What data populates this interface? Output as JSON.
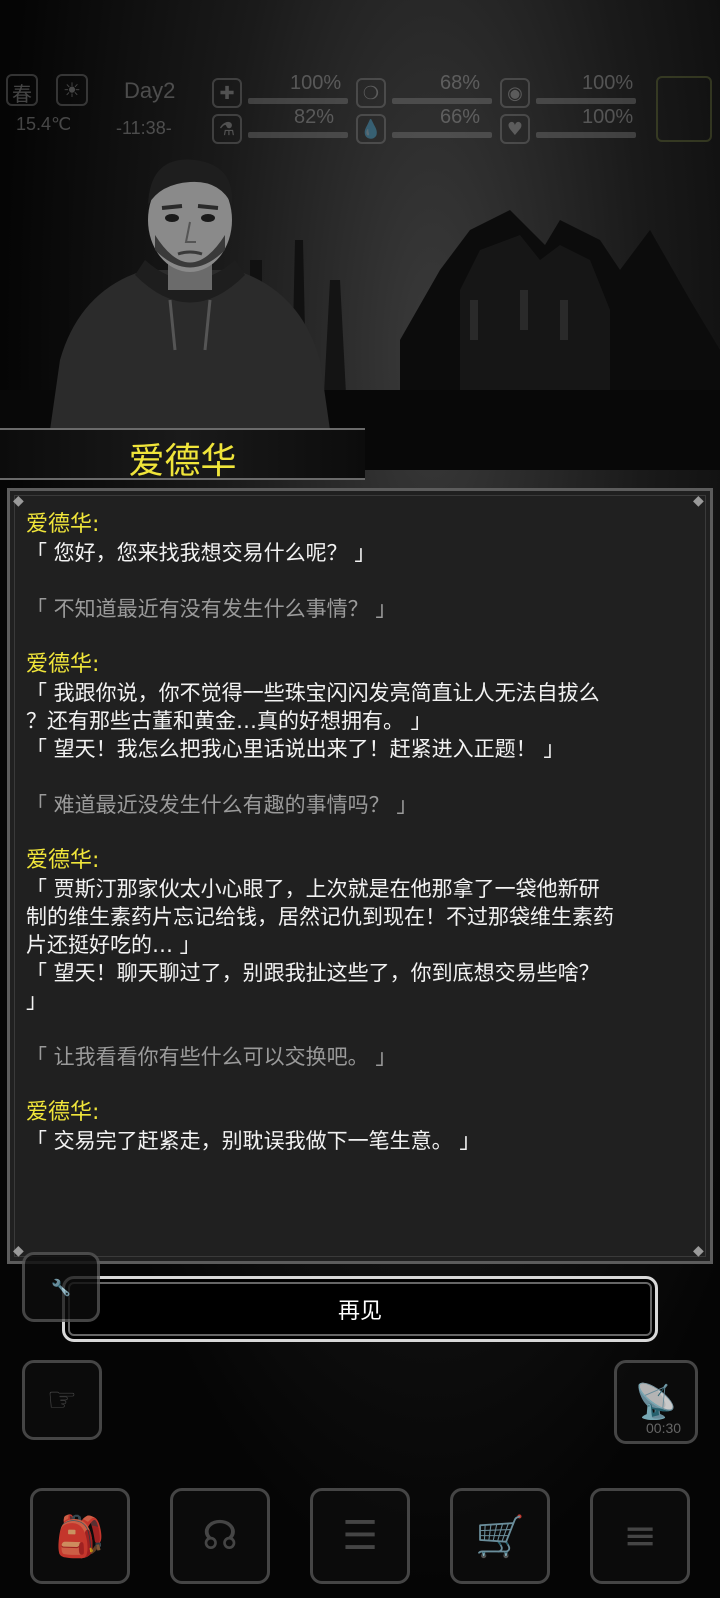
{
  "hud": {
    "season": "春",
    "temperature": "15.4℃",
    "day": "Day2",
    "time": "-11:38-",
    "stats": [
      {
        "icon": "medkit-icon",
        "value": "100%"
      },
      {
        "icon": "stomach-icon",
        "value": "68%"
      },
      {
        "icon": "pill-icon",
        "value": "100%"
      },
      {
        "icon": "flask-icon",
        "value": "82%"
      },
      {
        "icon": "water-drop-icon",
        "value": "66%"
      },
      {
        "icon": "heart-icon",
        "value": "100%"
      }
    ]
  },
  "npc": {
    "name": "爱德华"
  },
  "dialogue": {
    "speaker_label": "爱德华:",
    "entries": [
      {
        "npc": [
          "「 您好，您来找我想交易什么呢？ 」"
        ],
        "player": "「 不知道最近有没有发生什么事情？ 」"
      },
      {
        "npc": [
          "「 我跟你说，你不觉得一些珠宝闪闪发亮简直让人无法自拔么",
          "？还有那些古董和黄金…真的好想拥有。 」",
          "「 望天！我怎么把我心里话说出来了！赶紧进入正题！ 」"
        ],
        "player": "「 难道最近没发生什么有趣的事情吗？ 」"
      },
      {
        "npc": [
          "「 贾斯汀那家伙太小心眼了，上次就是在他那拿了一袋他新研",
          "制的维生素药片忘记给钱，居然记仇到现在！不过那袋维生素药",
          "片还挺好吃的… 」",
          "「 望天！聊天聊过了，别跟我扯这些了，你到底想交易些啥？",
          "」"
        ],
        "player": "「 让我看看你有些什么可以交换吧。 」"
      },
      {
        "npc": [
          "「 交易完了赶紧走，别耽误我做下一笔生意。 」"
        ],
        "player": ""
      }
    ]
  },
  "buttons": {
    "goodbye": "再见"
  },
  "bottom": {
    "timer": "00:30"
  }
}
